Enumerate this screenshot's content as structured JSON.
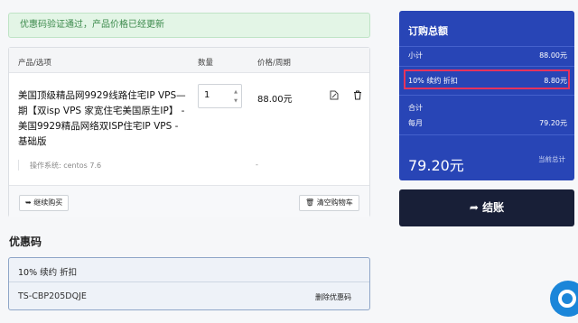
{
  "alert": {
    "message": "优惠码验证通过，产品价格已经更新"
  },
  "cart": {
    "headers": {
      "product": "产品/选项",
      "qty": "数量",
      "price": "价格/周期"
    },
    "item": {
      "name": "美国顶级精品网9929线路住宅IP VPS—期【双isp VPS 家宽住宅美国原生IP】 - 美国9929精品网络双ISP住宅IP VPS - 基础版",
      "quantity": "1",
      "price": "88.00元",
      "option_label": "操作系统: centos 7.6",
      "option_price": "-"
    },
    "continue_label": "继续购买",
    "clear_label": "清空购物车"
  },
  "coupon": {
    "title": "优惠码",
    "description": "10% 续约 折扣",
    "code": "TS-CBP205DQJE",
    "remove_label": "删除优惠码"
  },
  "summary": {
    "title": "订购总额",
    "subtotal_label": "小计",
    "subtotal_value": "88.00元",
    "discount_label": "10% 续约 折扣",
    "discount_value": "8.80元",
    "total_label": "合计",
    "monthly_label": "每月",
    "monthly_value": "79.20元",
    "grand_total": "79.20元",
    "due_label": "当前总计",
    "highlight_color": "#e5335d"
  },
  "checkout": {
    "label": "结账"
  },
  "icons": [
    "edit-icon",
    "trash-icon",
    "back-arrow-icon",
    "trash-icon",
    "checkout-arrow-icon",
    "chat-icon"
  ]
}
